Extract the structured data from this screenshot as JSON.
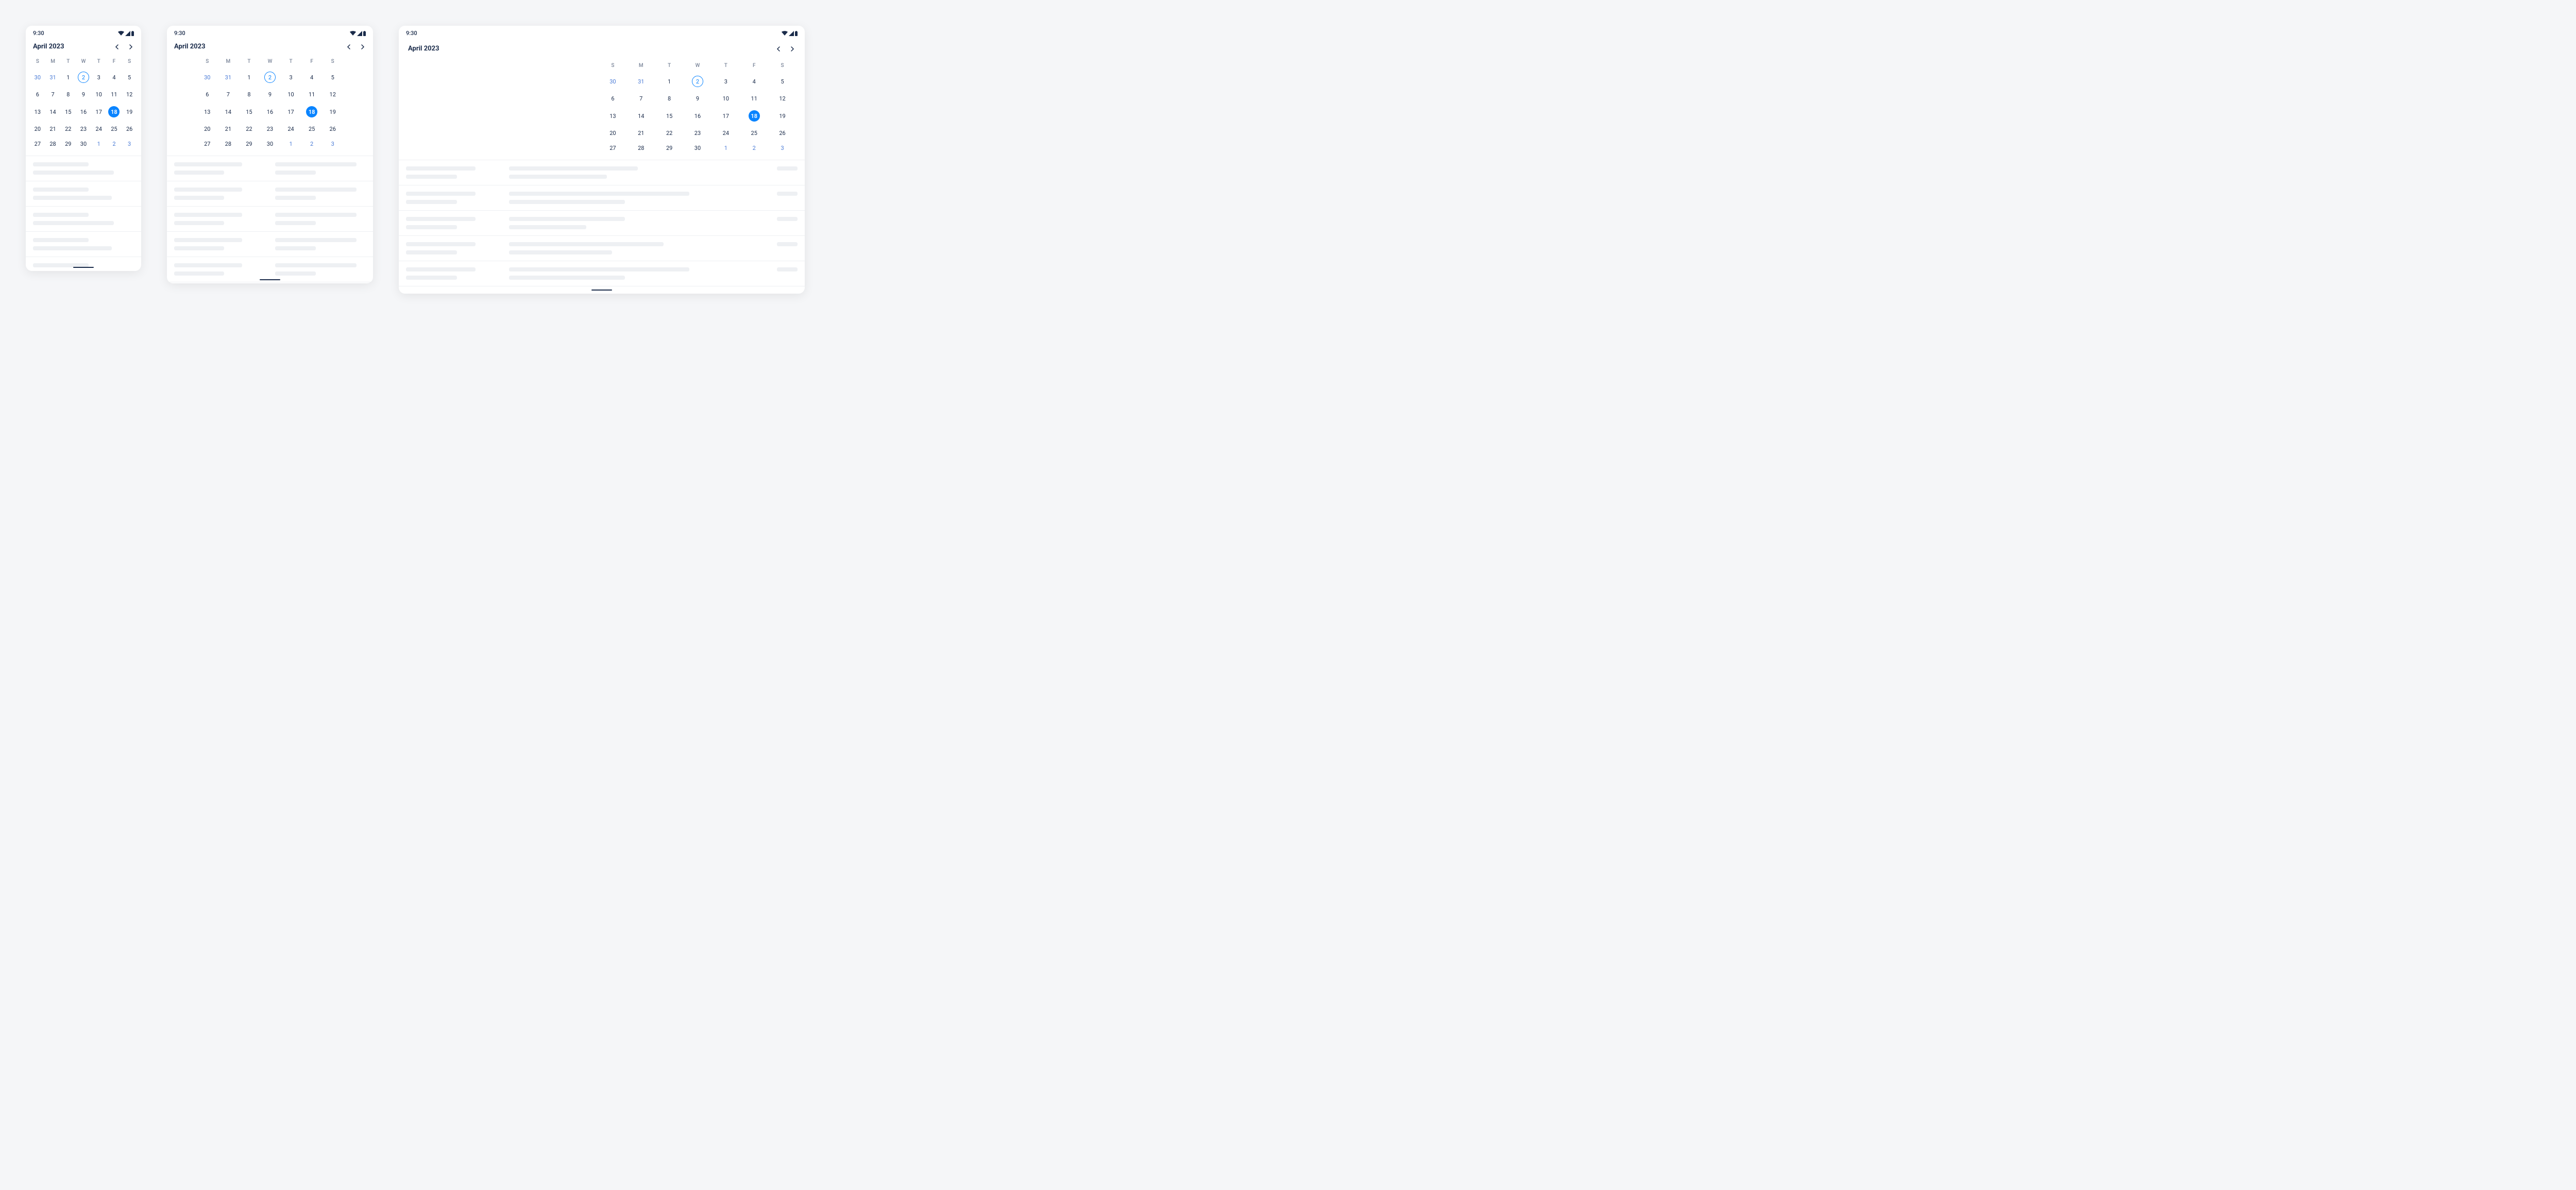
{
  "status": {
    "time": "9:30"
  },
  "calendar": {
    "title": "April 2023",
    "dow": [
      "S",
      "M",
      "T",
      "W",
      "T",
      "F",
      "S"
    ],
    "days": [
      {
        "n": 30,
        "other": true
      },
      {
        "n": 31,
        "other": true
      },
      {
        "n": 1
      },
      {
        "n": 2,
        "today": true
      },
      {
        "n": 3
      },
      {
        "n": 4
      },
      {
        "n": 5
      },
      {
        "n": 6
      },
      {
        "n": 7
      },
      {
        "n": 8
      },
      {
        "n": 9
      },
      {
        "n": 10
      },
      {
        "n": 11
      },
      {
        "n": 12
      },
      {
        "n": 13
      },
      {
        "n": 14
      },
      {
        "n": 15
      },
      {
        "n": 16
      },
      {
        "n": 17
      },
      {
        "n": 18,
        "selected": true
      },
      {
        "n": 19
      },
      {
        "n": 20
      },
      {
        "n": 21
      },
      {
        "n": 22
      },
      {
        "n": 23
      },
      {
        "n": 24
      },
      {
        "n": 25
      },
      {
        "n": 26
      },
      {
        "n": 27
      },
      {
        "n": 28
      },
      {
        "n": 29
      },
      {
        "n": 30
      },
      {
        "n": 1,
        "other": true
      },
      {
        "n": 2,
        "other": true
      },
      {
        "n": 3,
        "other": true
      }
    ]
  }
}
